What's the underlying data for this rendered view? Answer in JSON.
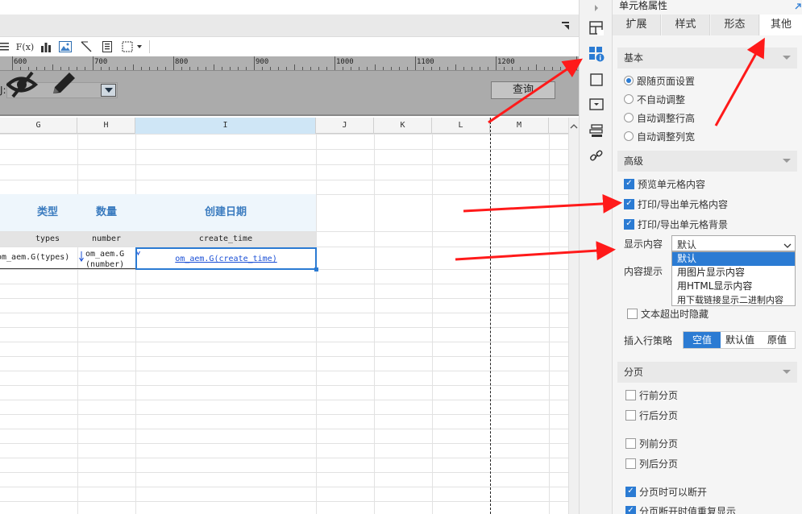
{
  "toolbar": {
    "items": [
      "F(x)"
    ],
    "top_right_icon": "collapse-icon"
  },
  "ruler": {
    "labels": [
      "600",
      "700",
      "800",
      "900",
      "1000",
      "1100",
      "1200"
    ]
  },
  "params": {
    "label_fragment": "J:",
    "query_button": "查询"
  },
  "columns": [
    "G",
    "H",
    "I",
    "J",
    "K",
    "L",
    "M"
  ],
  "report": {
    "headers": [
      "类型",
      "数量",
      "创建日期"
    ],
    "fields": [
      "types",
      "number",
      "create_time"
    ],
    "cells": [
      "om_aem.G(types)",
      "om_aem.G(number)",
      "om_aem.G(create_time)"
    ]
  },
  "panel": {
    "title": "单元格属性",
    "tabs": [
      "扩展",
      "样式",
      "形态",
      "其他"
    ],
    "active_tab": 3,
    "basic": {
      "title": "基本",
      "options": [
        "跟随页面设置",
        "不自动调整",
        "自动调整行高",
        "自动调整列宽"
      ],
      "selected": 0
    },
    "advanced": {
      "title": "高级",
      "checks": [
        {
          "label": "预览单元格内容",
          "checked": true
        },
        {
          "label": "打印/导出单元格内容",
          "checked": true
        },
        {
          "label": "打印/导出单元格背景",
          "checked": true
        }
      ],
      "display_label": "显示内容",
      "display_value": "默认",
      "display_options": [
        "默认",
        "用图片显示内容",
        "用HTML显示内容",
        "用下载链接显示二进制内容"
      ],
      "tooltip_label": "内容提示",
      "hide_overflow": "文本超出时隐藏",
      "insert_label": "插入行策略",
      "insert_options": [
        "空值",
        "默认值",
        "原值"
      ],
      "insert_selected": 0
    },
    "paging": {
      "title": "分页",
      "checks": [
        {
          "label": "行前分页",
          "checked": false
        },
        {
          "label": "行后分页",
          "checked": false
        },
        {
          "label": "列前分页",
          "checked": false
        },
        {
          "label": "列后分页",
          "checked": false
        },
        {
          "label": "分页时可以断开",
          "checked": true
        },
        {
          "label": "分页断开时值重复显示",
          "checked": true
        }
      ]
    }
  },
  "colors": {
    "accent": "#2b7bd3",
    "header_text": "#3a7bbf",
    "header_bg": "#eef6fc",
    "annotation_arrow": "#ff1a1a"
  }
}
